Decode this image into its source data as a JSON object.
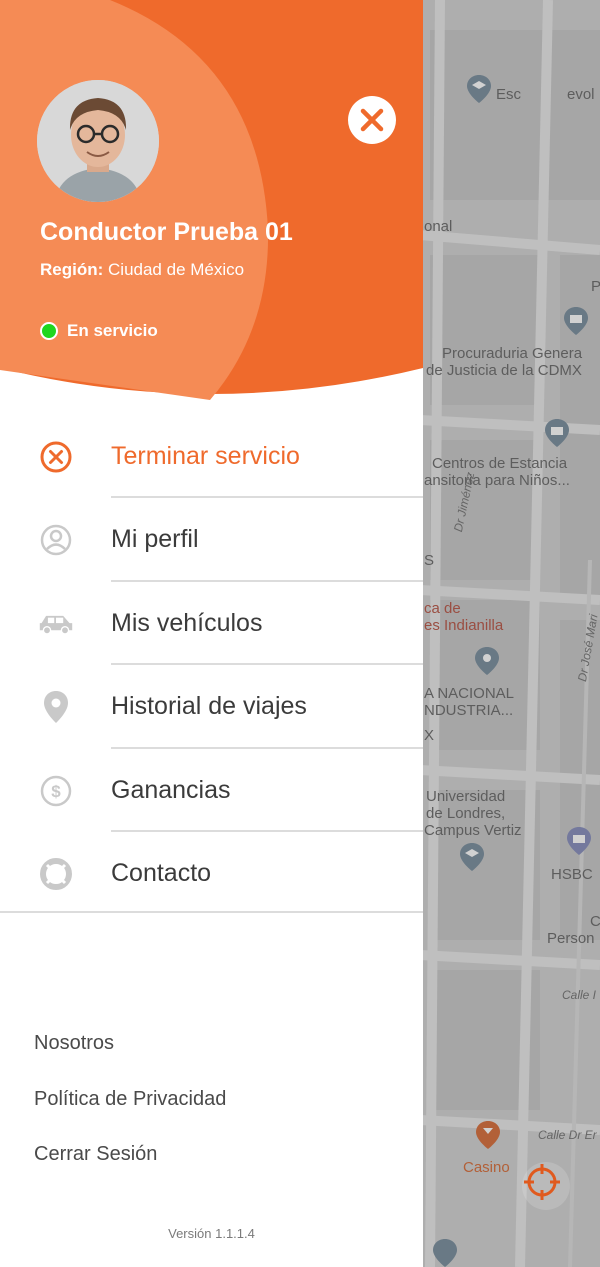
{
  "colors": {
    "accent": "#ef6a2c",
    "accent_light": "#f58b55",
    "status_online": "#1fd61f",
    "text": "#3b3b3b",
    "divider": "#dcdcdc"
  },
  "header": {
    "driver_name": "Conductor Prueba 01",
    "region_label": "Región:",
    "region_value": "Ciudad de México",
    "status_text": "En servicio",
    "avatar_icon": "user-photo",
    "close_icon": "close-icon"
  },
  "menu": {
    "items": [
      {
        "label": "Terminar servicio",
        "icon": "cancel-circle-icon",
        "active": true
      },
      {
        "label": "Mi perfil",
        "icon": "user-circle-icon"
      },
      {
        "label": "Mis vehículos",
        "icon": "car-icon"
      },
      {
        "label": "Historial de viajes",
        "icon": "location-pin-icon"
      },
      {
        "label": "Ganancias",
        "icon": "dollar-circle-icon"
      },
      {
        "label": "Contacto",
        "icon": "lifebuoy-icon"
      }
    ]
  },
  "footer": {
    "links": [
      "Nosotros",
      "Política de Privacidad",
      "Cerrar Sesión"
    ],
    "version": "Versión 1.1.1.4"
  },
  "map": {
    "labels": {
      "esc": "Esc",
      "evol": "evol",
      "onal": "onal",
      "procuraduria_1": "Procuraduria Genera",
      "procuraduria_2": "de Justicia de la CDMX",
      "centros_1": "Centros de Estancia",
      "centros_2": "ansitoria para Niños...",
      "dr_jimenez": "Dr Jiménez",
      "s_letter": "S",
      "ca_de": "ca de",
      "indianilla": "es Indianilla",
      "nacional_1": "A NACIONAL",
      "nacional_2": "NDUSTRIA...",
      "x_letter": "X",
      "dr_jose": "Dr José Mari",
      "universidad_1": "Universidad",
      "universidad_2": "de Londres,",
      "universidad_3": "Campus Vertiz",
      "hsbc": "HSBC",
      "c_letter": "C",
      "person": "Person",
      "calle_1": "Calle I",
      "calle_dr": "Calle Dr Er",
      "casino": "Casino",
      "p_letter": "P"
    },
    "locate_icon": "crosshair-icon",
    "profile_icon": "id-badge-icon"
  }
}
